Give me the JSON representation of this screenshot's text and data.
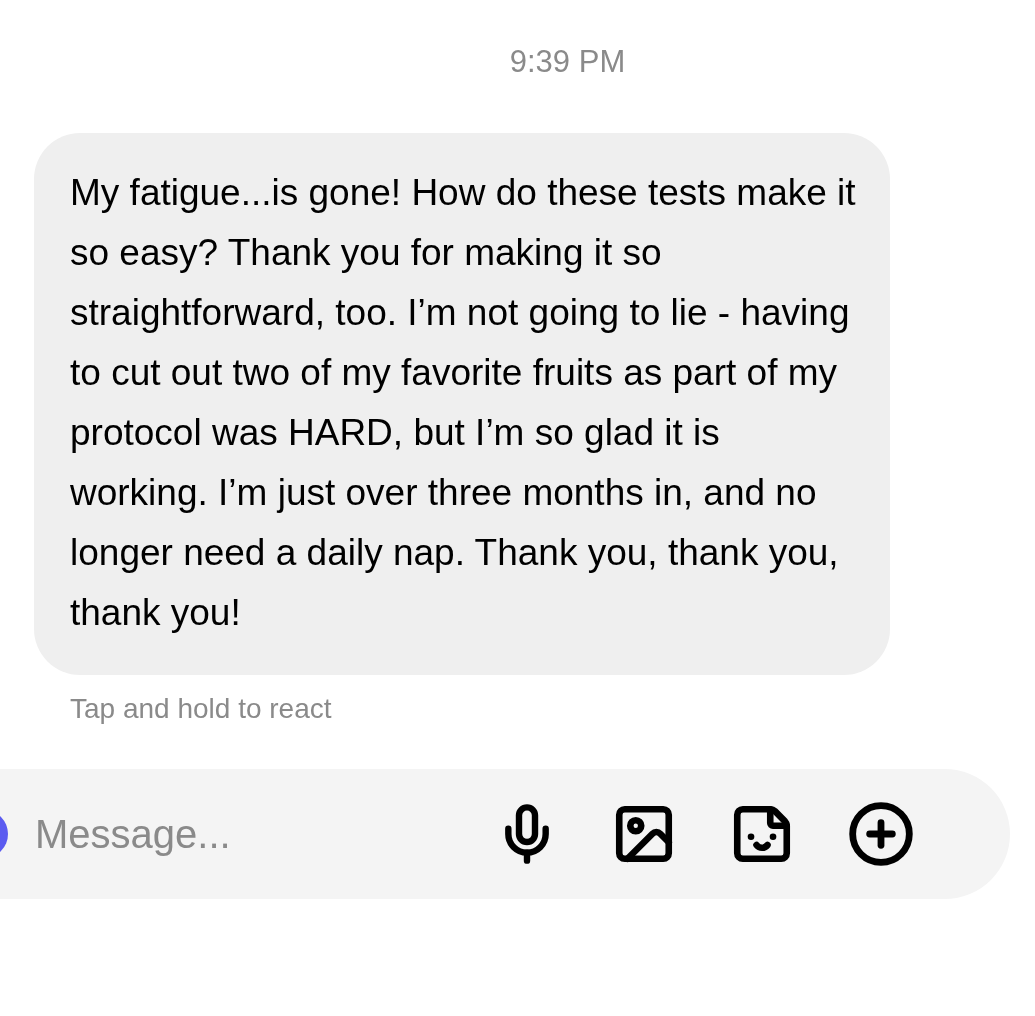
{
  "timestamp": "9:39 PM",
  "message": {
    "text": "My fatigue...is gone! How do these tests make it so easy? Thank you for making it so straightforward, too. I’m not going to lie - having to cut out two of my favorite fruits as part of my protocol was HARD, but I’m so glad it is working. I’m just over three months in, and no longer need a daily nap. Thank you, thank you, thank you!"
  },
  "hint": "Tap and hold to react",
  "composer": {
    "placeholder": "Message..."
  }
}
